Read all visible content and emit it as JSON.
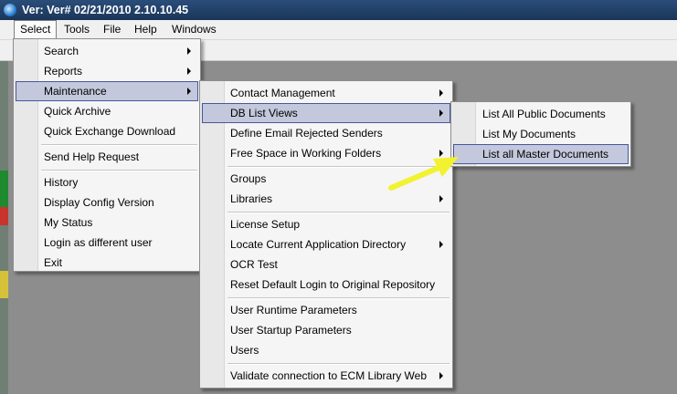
{
  "window": {
    "title": "Ver: Ver# 02/21/2010 2.10.10.45"
  },
  "menubar": {
    "items": [
      "Select",
      "Tools",
      "File",
      "Help",
      "Windows"
    ]
  },
  "select_menu": {
    "items": [
      "Search",
      "Reports",
      "Maintenance",
      "Quick Archive",
      "Quick Exchange Download",
      "Send Help Request",
      "History",
      "Display Config Version",
      "My Status",
      "Login as different user",
      "Exit"
    ]
  },
  "maintenance_menu": {
    "items": [
      "Contact Management",
      "DB List Views",
      "Define Email Rejected Senders",
      "Free Space in Working Folders",
      "Groups",
      "Libraries",
      "License Setup",
      "Locate Current Application Directory",
      "OCR Test",
      "Reset Default Login to Original Repository",
      "User Runtime Parameters",
      "User Startup Parameters",
      "Users",
      "Validate connection to ECM Library Web"
    ]
  },
  "db_list_views_menu": {
    "items": [
      "List All Public Documents",
      "List My Documents",
      "List all Master Documents"
    ]
  },
  "annotation": {
    "arrow_color": "#f2f230",
    "highlight": "#c3c8dc",
    "highlight_border": "#48589a"
  }
}
